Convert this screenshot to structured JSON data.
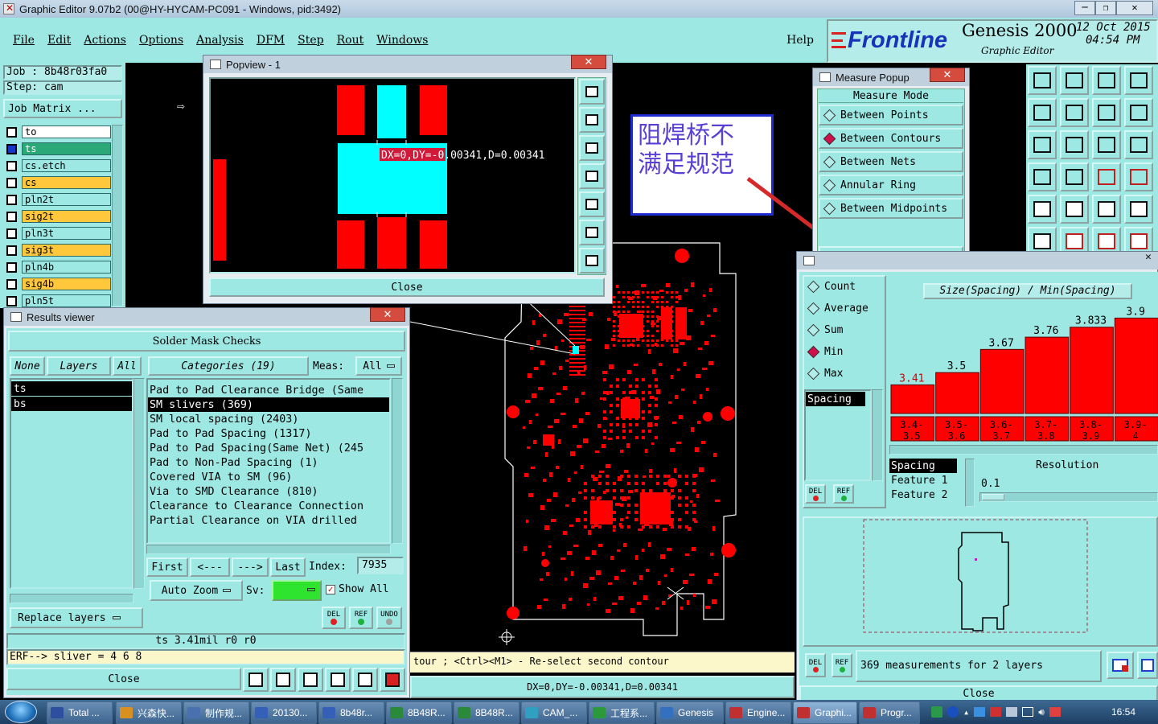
{
  "window": {
    "title": "Graphic Editor 9.07b2 (00@HY-HYCAM-PC091 - Windows, pid:3492)"
  },
  "menu": {
    "items": [
      "File",
      "Edit",
      "Actions",
      "Options",
      "Analysis",
      "DFM",
      "Step",
      "Rout",
      "Windows"
    ],
    "help": "Help"
  },
  "brand": {
    "logo": "Frontline",
    "product": "Genesis 2000",
    "subtitle": "Graphic Editor",
    "date": "12 Oct 2015",
    "time": "04:54 PM"
  },
  "job": {
    "job_label": "Job  : 8b48r03fa0",
    "step_label": "Step: cam",
    "matrix_button": "Job Matrix ..."
  },
  "layers": [
    {
      "name": "to",
      "color": "#ffffff"
    },
    {
      "name": "ts",
      "color": "#2aa878"
    },
    {
      "name": "cs.etch",
      "color": "#9ee8e4"
    },
    {
      "name": "cs",
      "color": "#ffc83c"
    },
    {
      "name": "pln2t",
      "color": "#9ee8e4"
    },
    {
      "name": "sig2t",
      "color": "#ffc83c"
    },
    {
      "name": "pln3t",
      "color": "#9ee8e4"
    },
    {
      "name": "sig3t",
      "color": "#ffc83c"
    },
    {
      "name": "pln4b",
      "color": "#9ee8e4"
    },
    {
      "name": "sig4b",
      "color": "#ffc83c"
    },
    {
      "name": "pln5t",
      "color": "#9ee8e4"
    }
  ],
  "popview": {
    "title": "Popview - 1",
    "measure_text": "DX=0,DY=-0.00341,D=0.00341",
    "close": "Close"
  },
  "annotation": {
    "text_line1": "阻焊桥不",
    "text_line2": "满足规范"
  },
  "measure_popup": {
    "title": "Measure Popup",
    "heading": "Measure Mode",
    "options": [
      "Between Points",
      "Between Contours",
      "Between Nets",
      "Annular Ring",
      "Between Midpoints"
    ],
    "selected": "Between Contours",
    "close": "Close"
  },
  "results": {
    "title": "Results viewer",
    "heading": "Solder Mask Checks",
    "none": "None",
    "layers_label": "Layers",
    "all": "All",
    "layer_items": [
      "ts",
      "bs"
    ],
    "categories_label": "Categories (19)",
    "meas_label": "Meas:",
    "meas_value": "All",
    "categories": [
      "Pad to Pad Clearance Bridge (Same",
      "SM slivers (369)",
      "SM local spacing (2403)",
      "Pad to Pad Spacing (1317)",
      "Pad to Pad Spacing(Same Net) (245",
      "Pad to Non-Pad Spacing (1)",
      "Covered VIA to SM (96)",
      "Via to SMD Clearance (810)",
      "Clearance to Clearance Connection",
      "Partial Clearance on VIA drilled"
    ],
    "selected_category": "SM slivers (369)",
    "nav": {
      "first": "First",
      "prev": "<---",
      "next": "--->",
      "last": "Last",
      "index_label": "Index:",
      "index_value": "7935"
    },
    "auto_zoom": "Auto Zoom",
    "sv_label": "Sv:",
    "show_all": "Show All",
    "replace_layers": "Replace layers",
    "status_line": "ts 3.41mil  r0  r0",
    "erf_line": "ERF--> sliver = 4 6 8",
    "close": "Close",
    "del": "DEL",
    "ref": "REF",
    "undo": "UNDO"
  },
  "hint_bar": {
    "text": "tour ; <Ctrl><M1> - Re-select second contour"
  },
  "coord_bar": {
    "text": "DX=0,DY=-0.00341,D=0.00341"
  },
  "histogram": {
    "stat_options": [
      "Count",
      "Average",
      "Sum",
      "Min",
      "Max"
    ],
    "selected_stat": "Min",
    "spacing_item": "Spacing",
    "chart_title": "Size(Spacing) / Min(Spacing)",
    "resolution_label": "Resolution",
    "resolution_value": "0.1",
    "legend": [
      "Spacing",
      "Feature 1",
      "Feature 2"
    ],
    "summary": "369 measurements for 2 layers",
    "close": "Close"
  },
  "chart_data": {
    "type": "bar",
    "title": "Size(Spacing) / Min(Spacing)",
    "categories": [
      "3.4-3.5",
      "3.5-3.6",
      "3.6-3.7",
      "3.7-3.8",
      "3.8-3.9",
      "3.9-4"
    ],
    "values": [
      3.41,
      3.5,
      3.67,
      3.76,
      3.833,
      3.9
    ],
    "value_labels": [
      "3.41",
      "3.5",
      "3.67",
      "3.76",
      "3.833",
      "3.9"
    ],
    "ylim": [
      3.2,
      3.92
    ]
  },
  "taskbar": {
    "items": [
      "Total ...",
      "兴森快...",
      "制作规...",
      "20130...",
      "8b48r...",
      "8B48R...",
      "8B48R...",
      "CAM_...",
      "工程系...",
      "Genesis",
      "Engine...",
      "Graphi...",
      "Progr..."
    ],
    "clock": "16:54"
  },
  "colors": {
    "panel": "#9ee8e4",
    "pcb_red": "#ff0000",
    "cyan_pad": "#00ffff",
    "selected_row": "#000000"
  }
}
